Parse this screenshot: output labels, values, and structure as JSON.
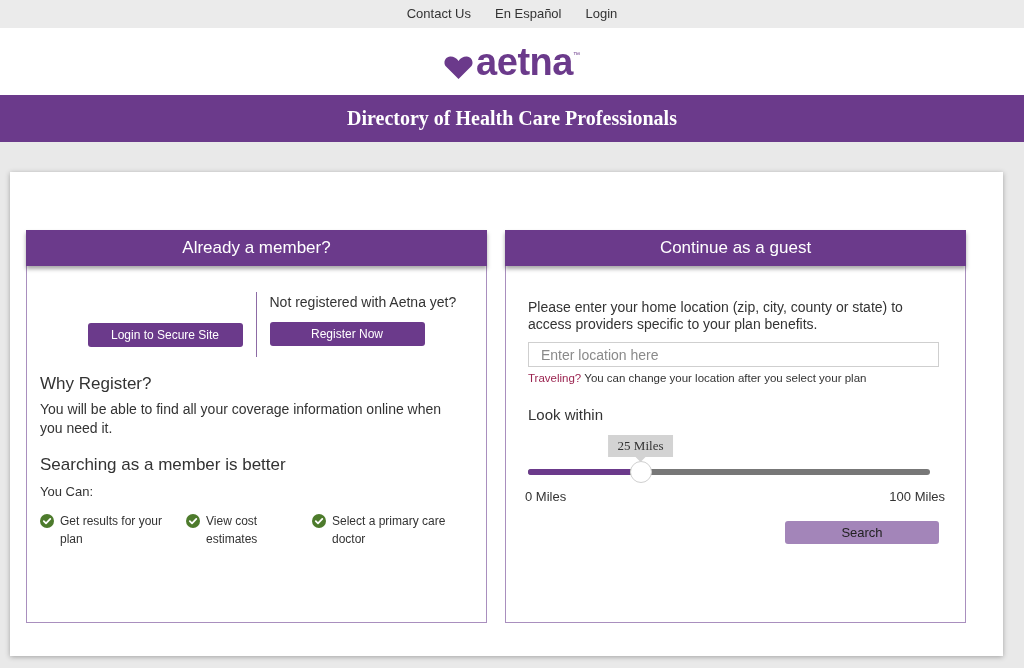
{
  "top_links": [
    {
      "label": "Contact Us"
    },
    {
      "label": "En Español"
    },
    {
      "label": "Login"
    }
  ],
  "logo": {
    "text": "aetna",
    "trademark": "™"
  },
  "banner": {
    "title": "Directory of Health Care Professionals"
  },
  "member_panel": {
    "title": "Already a member?",
    "login_button": "Login to Secure Site",
    "register_prompt": "Not registered with Aetna yet?",
    "register_button": "Register Now",
    "why_heading": "Why Register?",
    "why_text": "You will be able to find all your coverage information online when you need it.",
    "benefits_heading": "Searching as a member is better",
    "benefits_intro": "You Can:",
    "benefits": [
      {
        "text": "Get results for your plan"
      },
      {
        "text": "View cost estimates"
      },
      {
        "text": "Select a primary care doctor"
      }
    ]
  },
  "guest_panel": {
    "title": "Continue as a guest",
    "instructions": "Please enter your home location (zip, city, county or state) to access providers specific to your plan benefits.",
    "location_field": {
      "placeholder": "Enter location here"
    },
    "hint": {
      "link": "Traveling?",
      "text": "You can change your location after you select your plan"
    },
    "distance": {
      "label": "Look within",
      "reading": "25 Miles",
      "level": 0.28,
      "min_label": "0 Miles",
      "max_label": "100 Miles"
    },
    "search_button": {
      "label": "Search",
      "disabled": true
    }
  }
}
